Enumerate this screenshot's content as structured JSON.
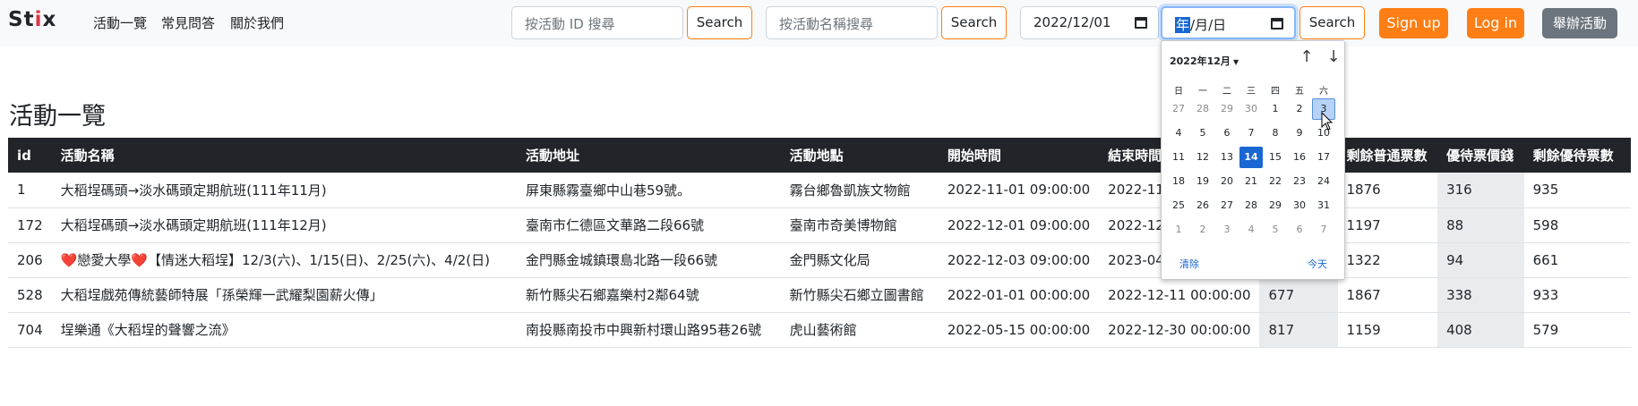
{
  "nav": {
    "brand_prefix": "St",
    "brand_accent": "i",
    "brand_suffix": "x",
    "links": [
      "活動一覽",
      "常見問答",
      "關於我們"
    ]
  },
  "search": {
    "id_placeholder": "按活動 ID 搜尋",
    "id_button": "Search",
    "name_placeholder": "按活動名稱搜尋",
    "name_button": "Search",
    "date_from_value": "2022/12/01",
    "date_to_year": "年",
    "date_to_rest": "/月/日",
    "date_button": "Search"
  },
  "auth": {
    "signup": "Sign up",
    "login": "Log in",
    "host": "舉辦活動"
  },
  "page_title": "活動一覽",
  "table": {
    "headers": [
      "id",
      "活動名稱",
      "活動地址",
      "活動地點",
      "開始時間",
      "結束時間",
      "",
      "剩餘普通票數",
      "優待票價錢",
      "剩餘優待票數"
    ],
    "rows": [
      [
        "1",
        "大稻埕碼頭→淡水碼頭定期航班(111年11月)",
        "屏東縣霧臺鄉中山巷59號。",
        "霧台鄉魯凱族文物館",
        "2022-11-01 09:00:00",
        "2022-11",
        "",
        "1876",
        "316",
        "935"
      ],
      [
        "172",
        "大稻埕碼頭→淡水碼頭定期航班(111年12月)",
        "臺南市仁德區文華路二段66號",
        "臺南市奇美博物館",
        "2022-12-01 09:00:00",
        "2022-12",
        "",
        "1197",
        "88",
        "598"
      ],
      [
        "206",
        "❤️戀愛大學❤️【情迷大稻埕】12/3(六)、1/15(日)、2/25(六)、4/2(日)",
        "金門縣金城鎮環島北路一段66號",
        "金門縣文化局",
        "2022-12-03 09:00:00",
        "2023-04",
        "",
        "1322",
        "94",
        "661"
      ],
      [
        "528",
        "大稻埕戲苑傳統藝師特展「孫榮輝一武耀梨園薪火傳」",
        "新竹縣尖石鄉嘉樂村2鄰64號",
        "新竹縣尖石鄉立圖書館",
        "2022-01-01 00:00:00",
        "2022-12-11 00:00:00",
        "677",
        "1867",
        "338",
        "933"
      ],
      [
        "704",
        "埕樂通《大稻埕的聲響之流》",
        "南投縣南投市中興新村環山路95巷26號",
        "虎山藝術館",
        "2022-05-15 00:00:00",
        "2022-12-30 00:00:00",
        "817",
        "1159",
        "408",
        "579"
      ]
    ]
  },
  "datepicker": {
    "month_label": "2022年12月",
    "prev_icon": "arrow-up-icon",
    "next_icon": "arrow-down-icon",
    "weekdays": [
      "日",
      "一",
      "二",
      "三",
      "四",
      "五",
      "六"
    ],
    "weeks": [
      [
        "27",
        "28",
        "29",
        "30",
        "1",
        "2",
        "3"
      ],
      [
        "4",
        "5",
        "6",
        "7",
        "8",
        "9",
        "10"
      ],
      [
        "11",
        "12",
        "13",
        "14",
        "15",
        "16",
        "17"
      ],
      [
        "18",
        "19",
        "20",
        "21",
        "22",
        "23",
        "24"
      ],
      [
        "25",
        "26",
        "27",
        "28",
        "29",
        "30",
        "31"
      ],
      [
        "1",
        "2",
        "3",
        "4",
        "5",
        "6",
        "7"
      ]
    ],
    "today": "14",
    "hovered": "3",
    "clear": "清除",
    "today_button": "今天"
  },
  "colors": {
    "accent": "#fd7e14",
    "dark": "#212529",
    "focus": "#86b7fe",
    "picker_highlight": "#1967d2"
  }
}
